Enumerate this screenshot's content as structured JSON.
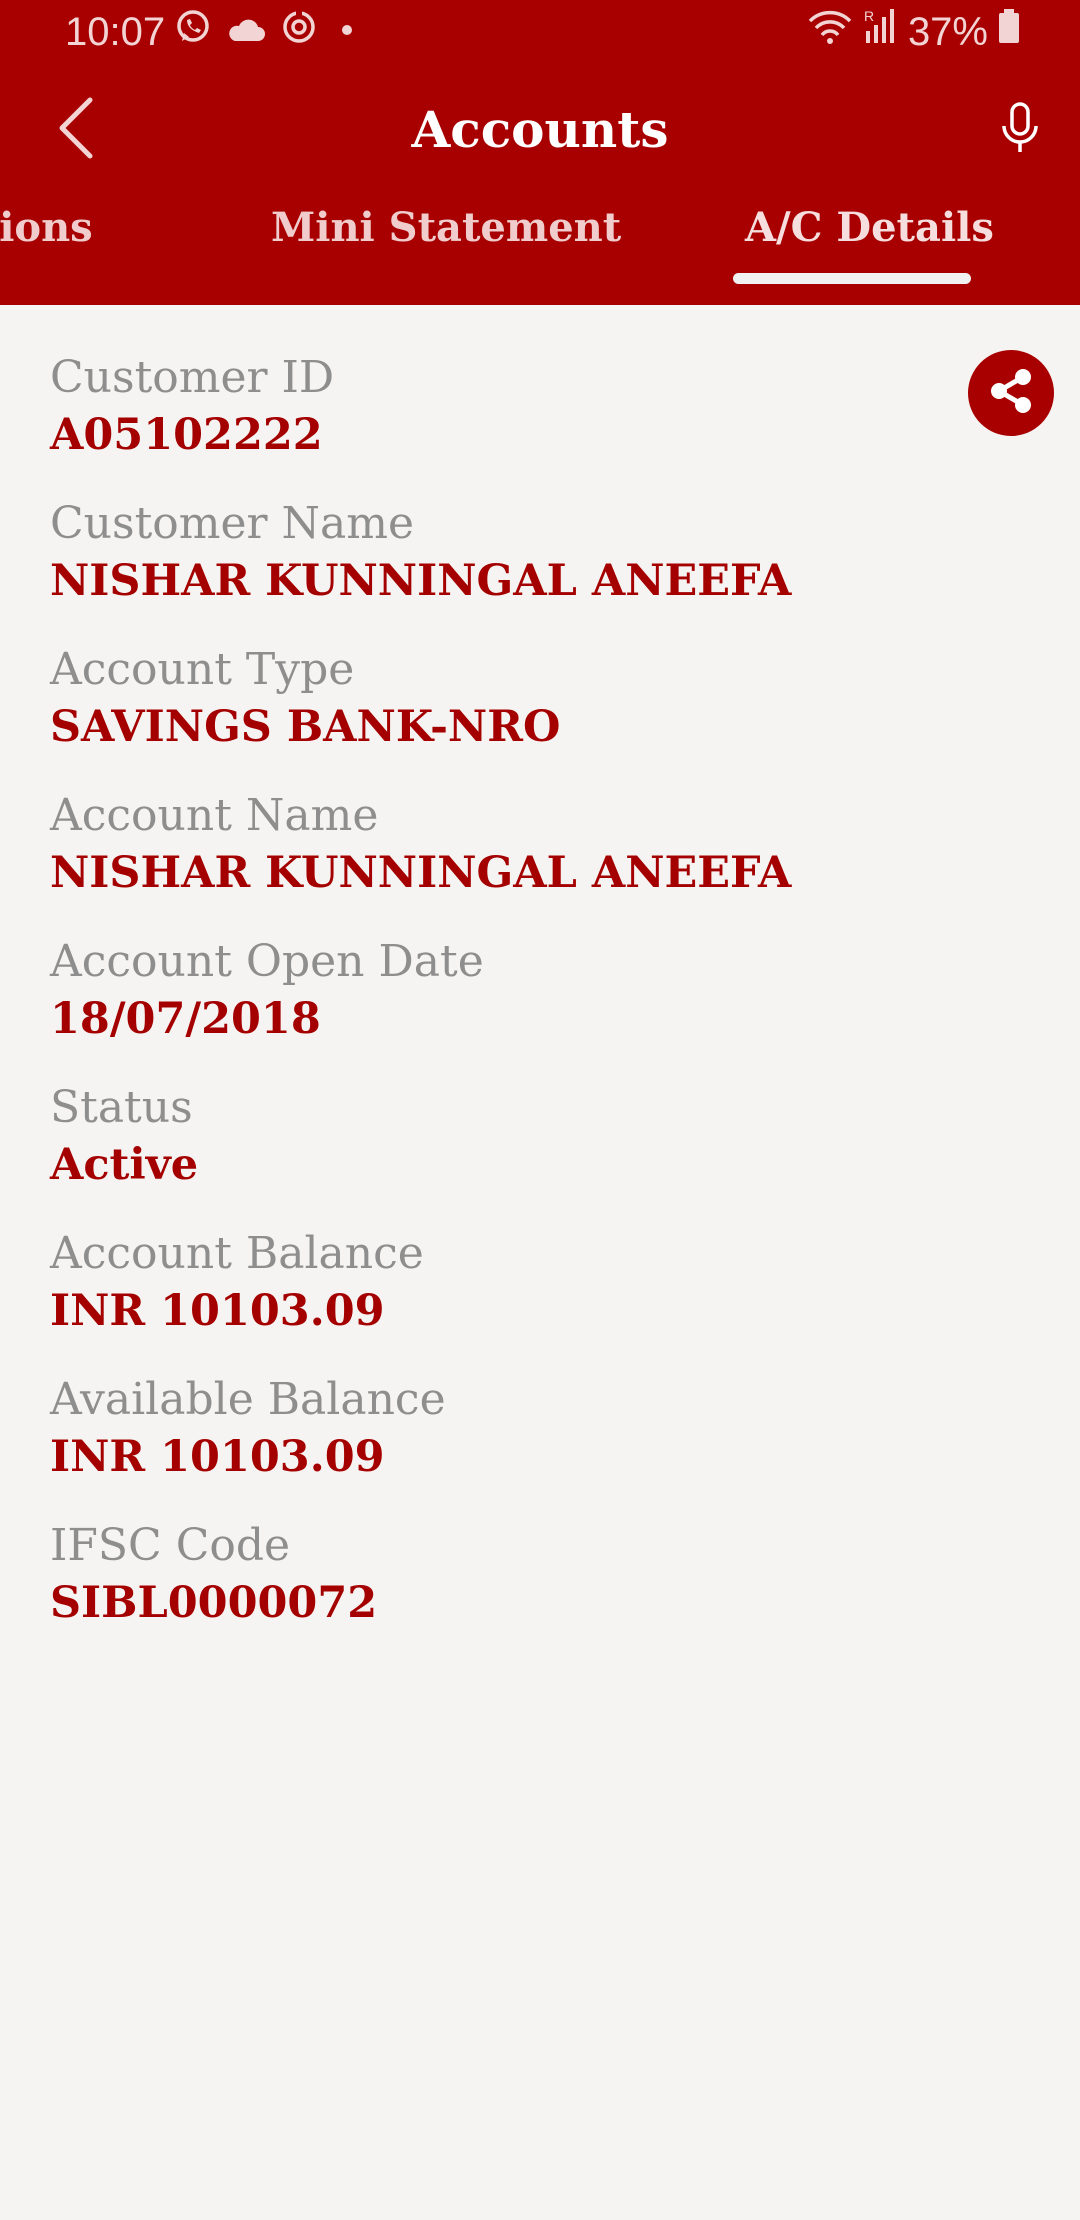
{
  "status_bar": {
    "time": "10:07",
    "battery": "37%",
    "icons": [
      "whatsapp-icon",
      "cloud-icon",
      "sync-icon",
      "dot-icon",
      "wifi-icon",
      "signal-icon",
      "battery-icon"
    ]
  },
  "toolbar": {
    "title": "Accounts",
    "back_icon": "back-arrow-icon",
    "mic_icon": "microphone-icon"
  },
  "tabs": [
    {
      "label": "Transactions",
      "active": false
    },
    {
      "label": "Mini Statement",
      "active": false
    },
    {
      "label": "A/C Details",
      "active": true
    }
  ],
  "share_icon": "share-icon",
  "colors": {
    "brand": "#a80000",
    "label": "#8e8e8e",
    "value": "#a50000",
    "background": "#f6f4f2"
  },
  "details": [
    {
      "label": "Customer ID",
      "value": "A05102222"
    },
    {
      "label": "Customer Name",
      "value": "NISHAR KUNNINGAL ANEEFA"
    },
    {
      "label": "Account Type",
      "value": "SAVINGS BANK-NRO"
    },
    {
      "label": "Account Name",
      "value": "NISHAR KUNNINGAL ANEEFA"
    },
    {
      "label": "Account Open Date",
      "value": "18/07/2018"
    },
    {
      "label": "Status",
      "value": "Active"
    },
    {
      "label": "Account Balance",
      "value": "INR 10103.09"
    },
    {
      "label": "Available Balance",
      "value": "INR 10103.09"
    },
    {
      "label": "IFSC Code",
      "value": "SIBL0000072"
    }
  ]
}
